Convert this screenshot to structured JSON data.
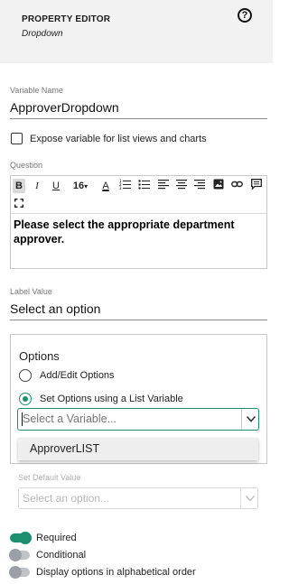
{
  "header": {
    "title": "PROPERTY EDITOR",
    "subtitle": "Dropdown",
    "help_icon": "question-circle-icon",
    "help_glyph": "?"
  },
  "variable_name": {
    "label": "Variable Name",
    "value": "ApproverDropdown"
  },
  "expose_checkbox": {
    "label": "Expose variable for list views and charts",
    "checked": false
  },
  "question": {
    "label": "Question",
    "toolbar": {
      "bold": "B",
      "italic": "I",
      "underline": "U",
      "font_size": "16",
      "font_size_caret": "▾",
      "font_color": "A",
      "icons": [
        "ordered-list-icon",
        "unordered-list-icon",
        "align-left-icon",
        "align-center-icon",
        "align-right-icon",
        "image-icon",
        "link-icon",
        "comment-icon",
        "fullscreen-icon"
      ]
    },
    "content": "Please select the appropriate department approver."
  },
  "label_value": {
    "label": "Label Value",
    "value": "Select an option"
  },
  "options": {
    "title": "Options",
    "radio_add_edit": {
      "label": "Add/Edit Options",
      "selected": false
    },
    "radio_list_variable": {
      "label": "Set Options using a List Variable",
      "selected": true
    },
    "variable_select": {
      "placeholder": "Select a Variable...",
      "chevron_icon": "chevron-down-icon"
    },
    "dropdown_menu": {
      "items": [
        "ApproverLIST"
      ]
    },
    "default_value": {
      "label": "Set Default Value",
      "placeholder": "Select an option...",
      "disabled": true
    }
  },
  "toggles": {
    "required": {
      "label": "Required",
      "on": true
    },
    "conditional": {
      "label": "Conditional",
      "on": false
    },
    "alphabetical": {
      "label": "Display options in alphabetical order",
      "on": false
    }
  },
  "colors": {
    "accent": "#1d8f6f",
    "header_bg": "#f2f2f2",
    "toggle_off": "#bfc3c8"
  }
}
